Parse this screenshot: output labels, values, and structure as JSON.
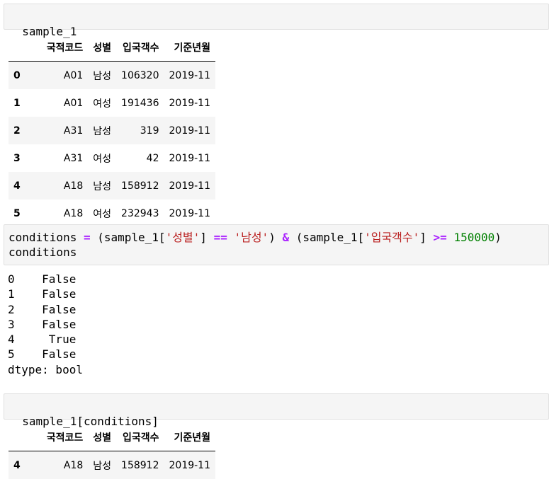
{
  "cells": [
    {
      "code": "sample_1"
    },
    {
      "code_tokens": {
        "var": "conditions",
        "eq": "=",
        "p1": "(sample_1[",
        "s1": "'성별'",
        "p2": "]",
        "eqeq": "==",
        "s2": "'남성'",
        "p3": ")",
        "amp": "&",
        "p4": "(sample_1[",
        "s3": "'입국객수'",
        "p5": "]",
        "ge": ">=",
        "num": "150000",
        "p6": ")",
        "line2": "conditions"
      }
    },
    {
      "code": "sample_1[conditions]"
    }
  ],
  "table1": {
    "columns": [
      "국적코드",
      "성별",
      "입국객수",
      "기준년월"
    ],
    "rows": [
      {
        "index": "0",
        "values": [
          "A01",
          "남성",
          "106320",
          "2019-11"
        ]
      },
      {
        "index": "1",
        "values": [
          "A01",
          "여성",
          "191436",
          "2019-11"
        ]
      },
      {
        "index": "2",
        "values": [
          "A31",
          "남성",
          "319",
          "2019-11"
        ]
      },
      {
        "index": "3",
        "values": [
          "A31",
          "여성",
          "42",
          "2019-11"
        ]
      },
      {
        "index": "4",
        "values": [
          "A18",
          "남성",
          "158912",
          "2019-11"
        ]
      },
      {
        "index": "5",
        "values": [
          "A18",
          "여성",
          "232943",
          "2019-11"
        ]
      }
    ]
  },
  "series_output": [
    "0    False",
    "1    False",
    "2    False",
    "3    False",
    "4     True",
    "5    False",
    "dtype: bool"
  ],
  "table2": {
    "columns": [
      "국적코드",
      "성별",
      "입국객수",
      "기준년월"
    ],
    "rows": [
      {
        "index": "4",
        "values": [
          "A18",
          "남성",
          "158912",
          "2019-11"
        ]
      }
    ]
  }
}
